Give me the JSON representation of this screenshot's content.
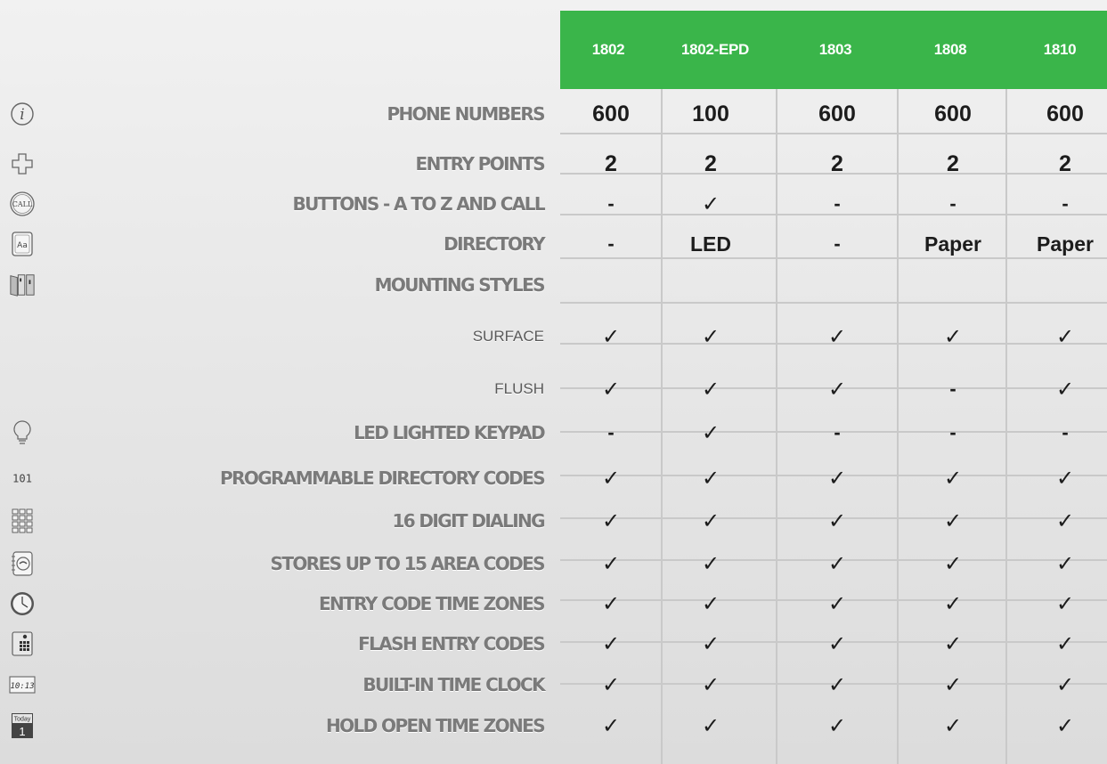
{
  "columns": [
    "1802",
    "1802-EPD",
    "1803",
    "1808",
    "1810"
  ],
  "rows": [
    {
      "icon": "info-icon",
      "label": "PHONE NUMBERS",
      "sub": false,
      "values": [
        "600",
        "100",
        "600",
        "600",
        "600"
      ]
    },
    {
      "icon": "plus-outline-icon",
      "label": "ENTRY POINTS",
      "sub": false,
      "values": [
        "2",
        "2",
        "2",
        "2",
        "2"
      ]
    },
    {
      "icon": "call-button-icon",
      "label": "BUTTONS - A TO Z AND CALL",
      "sub": false,
      "values": [
        "-",
        "✓",
        "-",
        "-",
        "-"
      ]
    },
    {
      "icon": "directory-aa-icon",
      "label": "DIRECTORY",
      "sub": false,
      "values": [
        "-",
        "LED",
        "-",
        "Paper",
        "Paper"
      ]
    },
    {
      "icon": "panels-icon",
      "label": "MOUNTING STYLES",
      "sub": false,
      "values": [
        "",
        "",
        "",
        "",
        ""
      ]
    },
    {
      "icon": "",
      "label": "SURFACE",
      "sub": true,
      "values": [
        "✓",
        "✓",
        "✓",
        "✓",
        "✓"
      ]
    },
    {
      "icon": "",
      "label": "FLUSH",
      "sub": true,
      "values": [
        "✓",
        "✓",
        "✓",
        "-",
        "✓"
      ]
    },
    {
      "icon": "lightbulb-icon",
      "label": "LED LIGHTED KEYPAD",
      "sub": false,
      "values": [
        "-",
        "✓",
        "-",
        "-",
        "-"
      ]
    },
    {
      "icon": "binary-101-icon",
      "label": "PROGRAMMABLE DIRECTORY CODES",
      "sub": false,
      "values": [
        "✓",
        "✓",
        "✓",
        "✓",
        "✓"
      ]
    },
    {
      "icon": "keypad-grid-icon",
      "label": "16 DIGIT DIALING",
      "sub": false,
      "values": [
        "✓",
        "✓",
        "✓",
        "✓",
        "✓"
      ]
    },
    {
      "icon": "phone-book-icon",
      "label": "STORES UP TO 15 AREA CODES",
      "sub": false,
      "values": [
        "✓",
        "✓",
        "✓",
        "✓",
        "✓"
      ]
    },
    {
      "icon": "clock-icon",
      "label": "ENTRY CODE TIME ZONES",
      "sub": false,
      "values": [
        "✓",
        "✓",
        "✓",
        "✓",
        "✓"
      ]
    },
    {
      "icon": "entry-keypad-icon",
      "label": "FLASH ENTRY CODES",
      "sub": false,
      "values": [
        "✓",
        "✓",
        "✓",
        "✓",
        "✓"
      ]
    },
    {
      "icon": "digital-clock-icon",
      "label": "BUILT-IN TIME CLOCK",
      "sub": false,
      "values": [
        "✓",
        "✓",
        "✓",
        "✓",
        "✓"
      ]
    },
    {
      "icon": "calendar-today-icon",
      "label": "HOLD OPEN TIME ZONES",
      "sub": false,
      "values": [
        "✓",
        "✓",
        "✓",
        "✓",
        "✓"
      ]
    }
  ],
  "icon_text": {
    "call": "CALL",
    "directory": "Aa",
    "binary": "101",
    "digital_clock": "10:13",
    "calendar_today": "Today",
    "calendar_day": "1"
  },
  "colors": {
    "header": "#3ab54a",
    "label": "#7a7a7a"
  }
}
